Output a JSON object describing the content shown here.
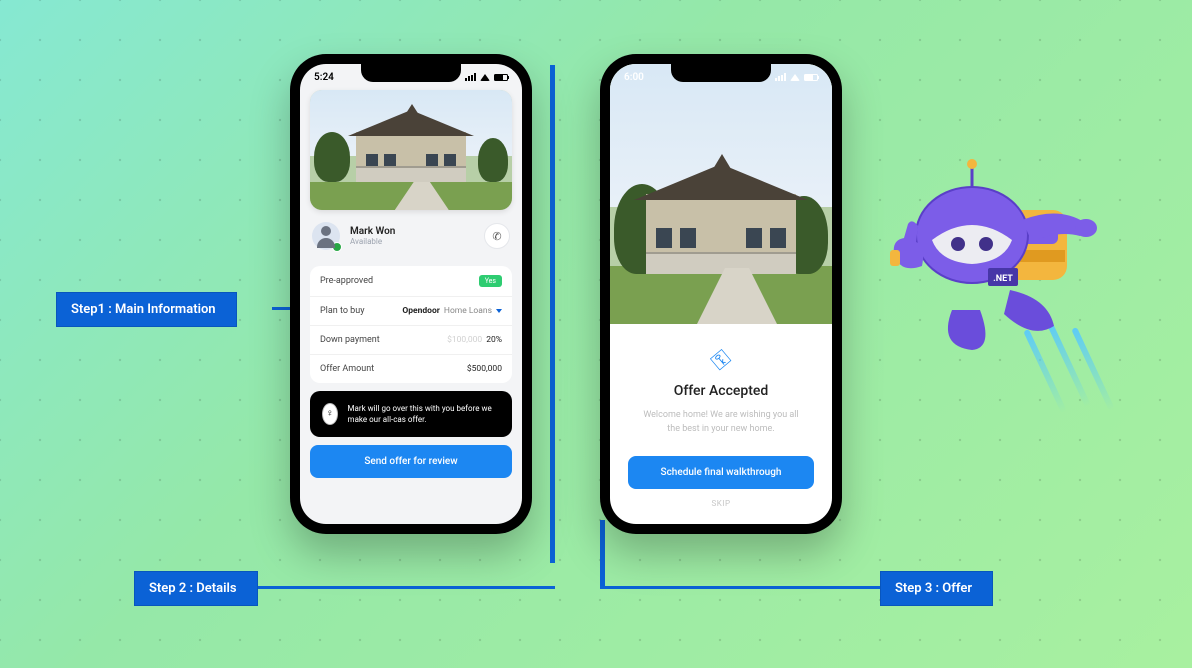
{
  "steps": {
    "s1": "Step1 : Main Information",
    "s2": "Step 2 : Details",
    "s3": "Step 3 : Offer"
  },
  "phone1": {
    "time": "5:24",
    "profile": {
      "name": "Mark Won",
      "status": "Available"
    },
    "rows": {
      "preapproved": {
        "label": "Pre-approved",
        "badge": "Yes"
      },
      "plan": {
        "label": "Plan to buy",
        "brand": "Opendoor",
        "suffix": "Home Loans"
      },
      "down": {
        "label": "Down payment",
        "placeholder": "$100,000",
        "pct": "20%"
      },
      "offer": {
        "label": "Offer Amount",
        "value": "$500,000"
      }
    },
    "tip": "Mark will go over this with you before we make our all-cas offer.",
    "cta": "Send offer for review"
  },
  "phone2": {
    "time": "6:00",
    "title": "Offer Accepted",
    "subtitle": "Welcome home! We are wishing you all the best in your new home.",
    "cta": "Schedule final walkthrough",
    "skip": "SKIP"
  },
  "robot": {
    "badge": ".NET"
  }
}
